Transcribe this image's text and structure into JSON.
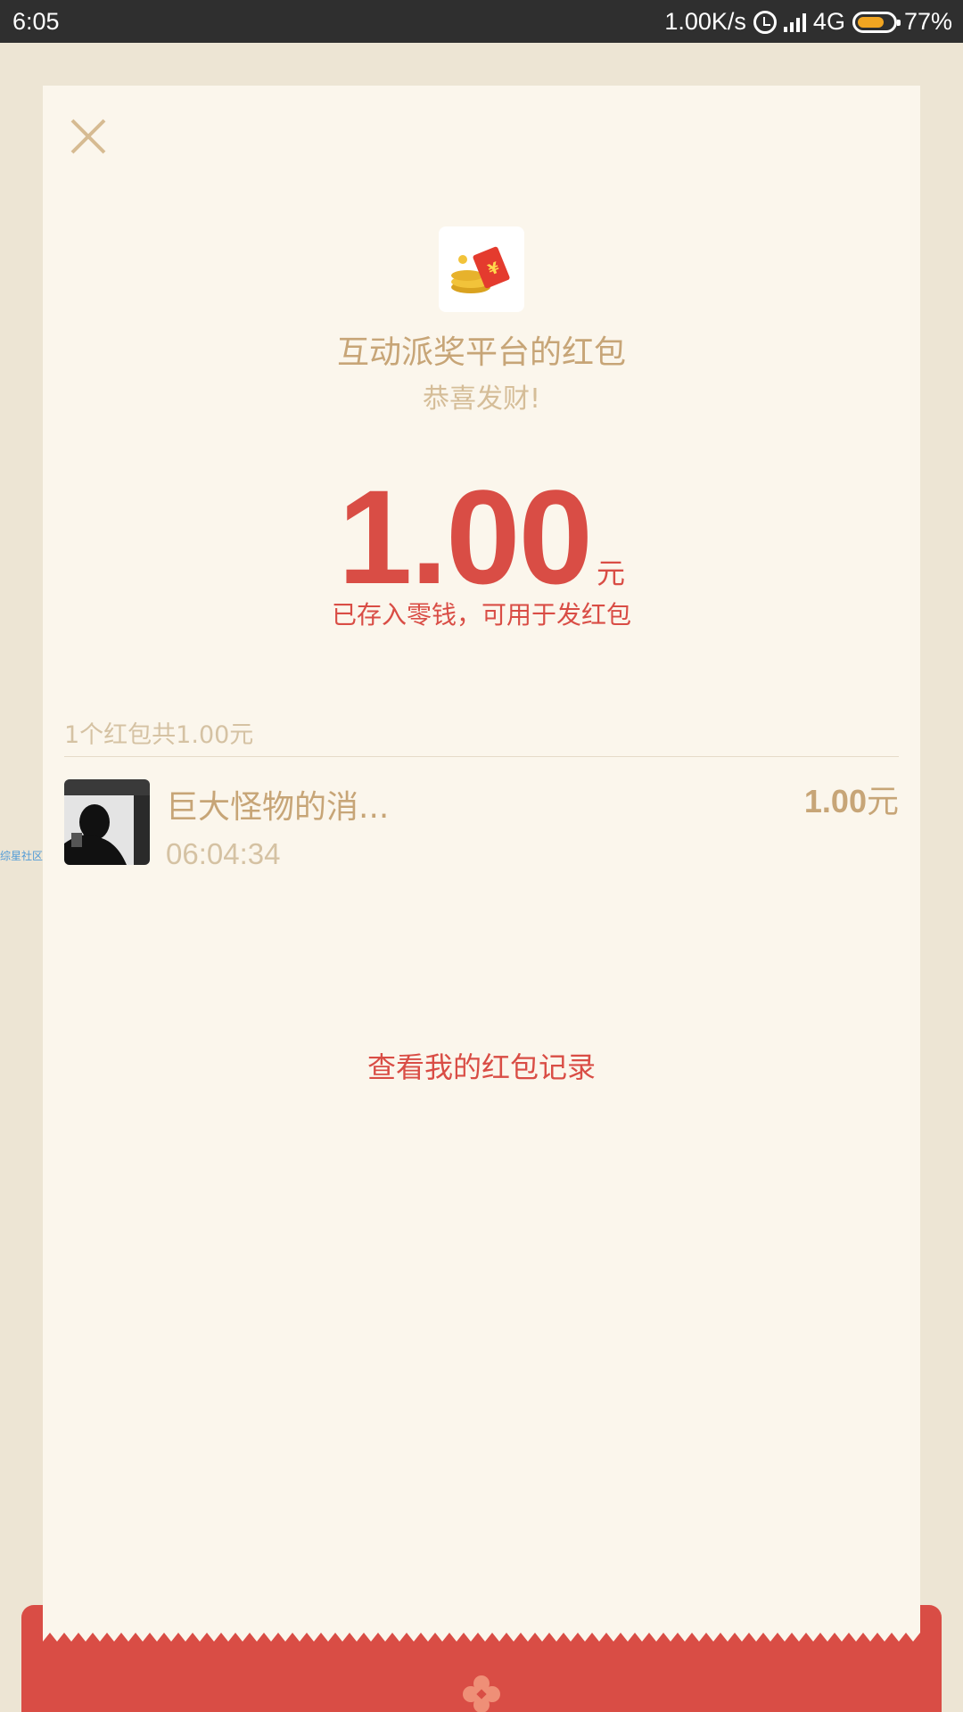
{
  "status_bar": {
    "time": "6:05",
    "network_speed": "1.00K/s",
    "network_type": "4G",
    "battery": "77%",
    "battery_level": 0.77
  },
  "packet": {
    "title": "互动派奖平台的红包",
    "subtitle": "恭喜发财!",
    "amount": "1.00",
    "unit": "元",
    "saved_note": "已存入零钱，可用于发红包"
  },
  "records": {
    "summary": "1个红包共1.00元",
    "items": [
      {
        "name": "巨大怪物的消...",
        "time": "06:04:34",
        "amount": "1.00",
        "unit": "元"
      }
    ]
  },
  "history_link": "查看我的红包记录",
  "watermark": "综星社区",
  "colors": {
    "accent_red": "#d94d45",
    "gold_text": "#c7a577",
    "card_background": "#fbf6ec"
  }
}
